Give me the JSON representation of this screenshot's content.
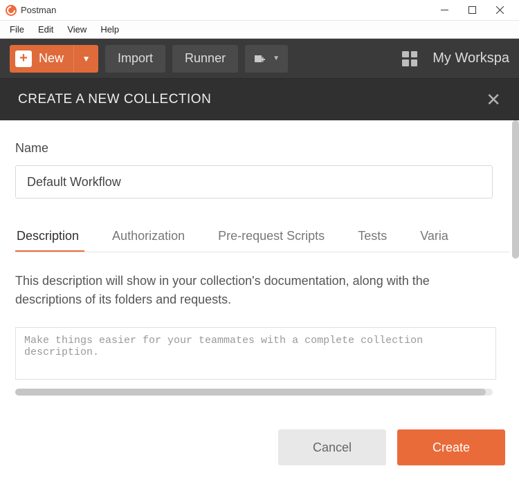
{
  "window": {
    "app_title": "Postman",
    "menus": [
      "File",
      "Edit",
      "View",
      "Help"
    ]
  },
  "toolbar": {
    "new_label": "New",
    "import_label": "Import",
    "runner_label": "Runner",
    "workspace_label": "My Workspa"
  },
  "modal": {
    "title": "CREATE A NEW COLLECTION",
    "name_label": "Name",
    "name_value": "Default Workflow",
    "tabs": {
      "description": "Description",
      "authorization": "Authorization",
      "prerequest": "Pre-request Scripts",
      "tests": "Tests",
      "variables": "Varia"
    },
    "description_help": "This description will show in your collection's documentation, along with the descriptions of its folders and requests.",
    "description_placeholder": "Make things easier for your teammates with a complete collection description.",
    "cancel_label": "Cancel",
    "create_label": "Create"
  }
}
